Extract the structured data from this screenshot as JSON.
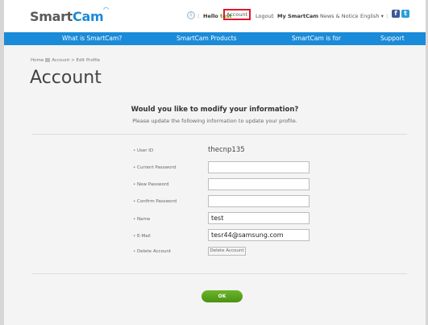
{
  "header": {
    "logo_prefix": "Smart",
    "logo_suffix": "Cam",
    "hello_prefix": "Hello",
    "username": "test",
    "account_link": "Account",
    "logout_link": "Logout",
    "my_smartcam_link": "My SmartCam",
    "news_link": "News & Notice",
    "language": "English",
    "language_caret": "▾",
    "facebook_glyph": "f",
    "twitter_glyph": "t",
    "separator": "|",
    "user_glyph": "i"
  },
  "nav": {
    "items": [
      "What is SmartCam?",
      "SmartCam Products",
      "SmartCam is for",
      "Support"
    ]
  },
  "breadcrumb": {
    "home": "Home",
    "path": "Account > Edit Profile"
  },
  "page": {
    "title": "Account",
    "question": "Would you like to modify your information?",
    "subtitle": "Please update the following information to update your profile."
  },
  "form": {
    "user_id_label": "User ID",
    "user_id_value": "thecnp135",
    "current_password_label": "Current Password",
    "current_password_value": "",
    "new_password_label": "New Password",
    "new_password_value": "",
    "confirm_password_label": "Confirm Password",
    "confirm_password_value": "",
    "name_label": "Name",
    "name_value": "test",
    "email_label": "E-Mail",
    "email_value": "tesr44@samsung.com",
    "delete_label": "Delete Account",
    "delete_button": "Delete Account",
    "ok_button": "OK"
  },
  "colors": {
    "nav_blue": "#1a8bd8",
    "ok_green": "#5aa41e",
    "highlight_red": "#e3162a"
  }
}
